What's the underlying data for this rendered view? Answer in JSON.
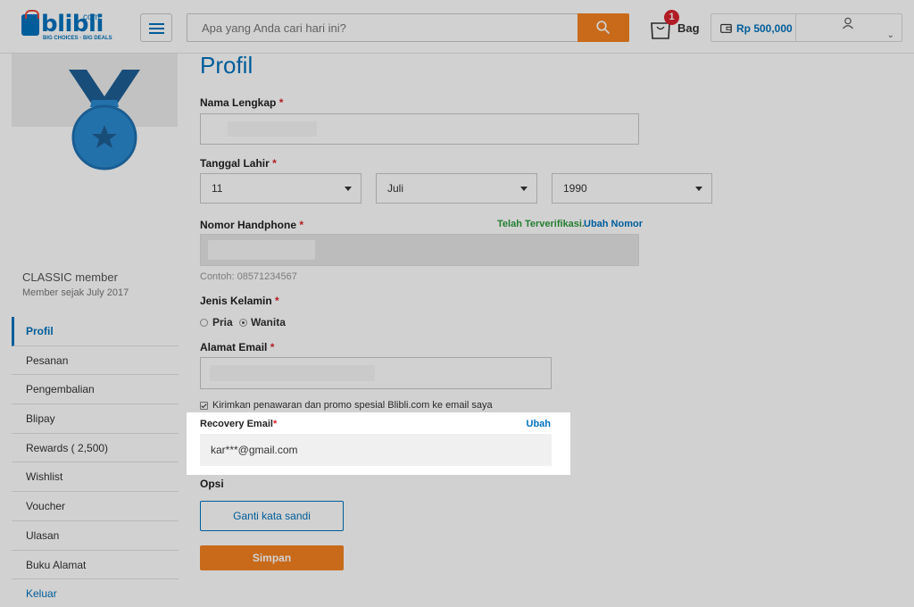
{
  "brand": {
    "logo_text": "blibli",
    "logo_suffix": "com",
    "tagline": "BIG CHOICES · BIG DEALS",
    "primary_color": "#0072bc",
    "accent_color": "#f58220"
  },
  "header": {
    "search_placeholder": "Apa yang Anda cari hari ini?",
    "bag_count": "1",
    "bag_label": "Bag",
    "wallet_amount": "Rp 500,000"
  },
  "sidebar": {
    "member_title": "CLASSIC member",
    "member_since": "Member sejak July 2017",
    "items": [
      {
        "label": "Profil"
      },
      {
        "label": "Pesanan"
      },
      {
        "label": "Pengembalian"
      },
      {
        "label": "Blipay"
      },
      {
        "label": "Rewards ( 2,500)"
      },
      {
        "label": "Wishlist"
      },
      {
        "label": "Voucher"
      },
      {
        "label": "Ulasan"
      },
      {
        "label": "Buku Alamat"
      },
      {
        "label": "Keluar"
      }
    ]
  },
  "profile": {
    "title": "Profil",
    "full_name_label": "Nama Lengkap",
    "birth_label": "Tanggal Lahir",
    "birth_day": "11",
    "birth_month": "Juli",
    "birth_year": "1990",
    "phone_label": "Nomor Handphone",
    "verified_text": "Telah Terverifikasi.",
    "change_number": "Ubah Nomor",
    "phone_hint": "Contoh: 08571234567",
    "gender_label": "Jenis Kelamin",
    "gender_options": [
      "Pria",
      "Wanita"
    ],
    "gender_selected": "Wanita",
    "email_label": "Alamat Email",
    "promo_checkbox": "Kirimkan penawaran dan promo spesial Blibli.com ke email saya",
    "recovery_label": "Recovery Email",
    "recovery_edit": "Ubah",
    "recovery_value": "kar***@gmail.com",
    "options_label": "Opsi",
    "change_password": "Ganti kata sandi",
    "save": "Simpan",
    "required_mark": "*"
  }
}
